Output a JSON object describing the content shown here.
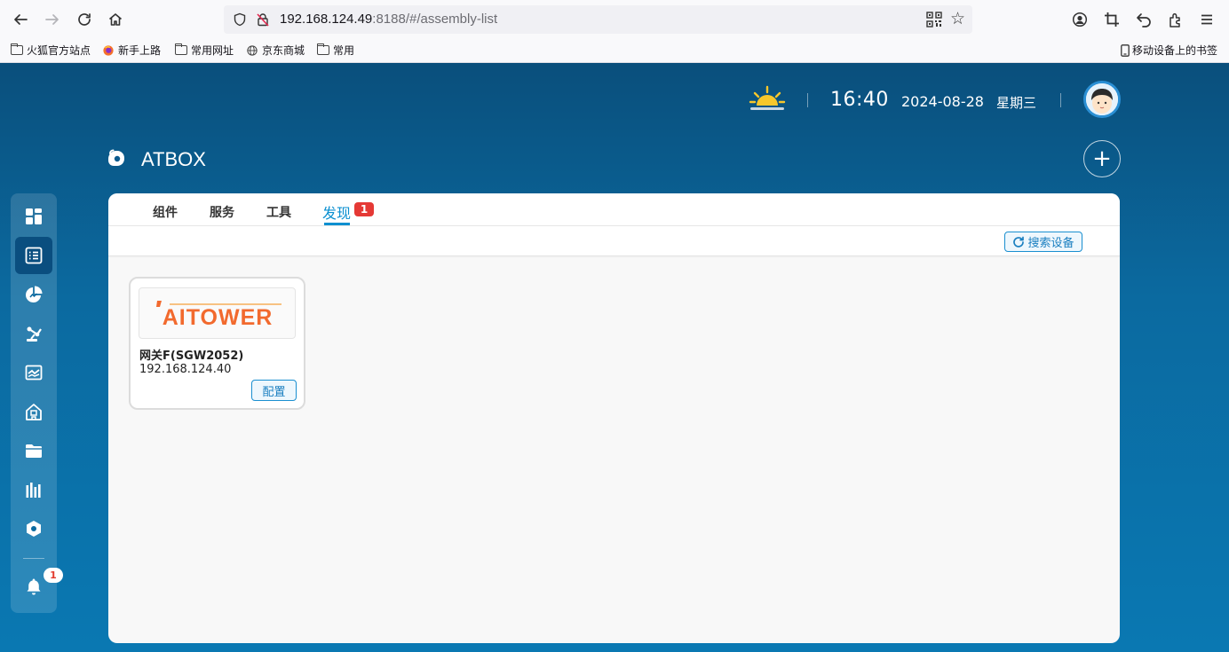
{
  "browser": {
    "url_host": "192.168.124.49",
    "url_rest": ":8188/#/assembly-list",
    "bookmarks": [
      {
        "label": "火狐官方站点",
        "icon": "folder-icon"
      },
      {
        "label": "新手上路",
        "icon": "firefox-icon"
      },
      {
        "label": "常用网址",
        "icon": "folder-icon"
      },
      {
        "label": "京东商城",
        "icon": "globe-icon"
      },
      {
        "label": "常用",
        "icon": "folder-icon"
      }
    ],
    "mobile_bookmarks": "移动设备上的书签"
  },
  "header": {
    "time": "16:40",
    "date": "2024-08-28",
    "weekday": "星期三",
    "weather_icon": "sunrise-icon"
  },
  "app": {
    "title": "ATBOX",
    "add_label": "+"
  },
  "sidebar": {
    "items": [
      {
        "name": "dashboard-icon"
      },
      {
        "name": "list-icon",
        "active": true
      },
      {
        "name": "chart-pie-icon"
      },
      {
        "name": "robot-arm-icon"
      },
      {
        "name": "monitor-chart-icon"
      },
      {
        "name": "home-building-icon"
      },
      {
        "name": "folder-icon"
      },
      {
        "name": "bar-stats-icon"
      },
      {
        "name": "hex-settings-icon"
      }
    ],
    "notification_count": "1"
  },
  "tabs": [
    {
      "label": "组件"
    },
    {
      "label": "服务"
    },
    {
      "label": "工具"
    },
    {
      "label": "发现",
      "active": true,
      "badge": "1"
    }
  ],
  "toolbar": {
    "search_label": "搜索设备"
  },
  "devices": [
    {
      "logo_text": "AITOWER",
      "name": "网关F(SGW2052)",
      "ip": "192.168.124.40",
      "config_label": "配置"
    }
  ],
  "colors": {
    "accent": "#0a8fd0",
    "badge": "#e53935",
    "logo": "#f26a2e"
  }
}
